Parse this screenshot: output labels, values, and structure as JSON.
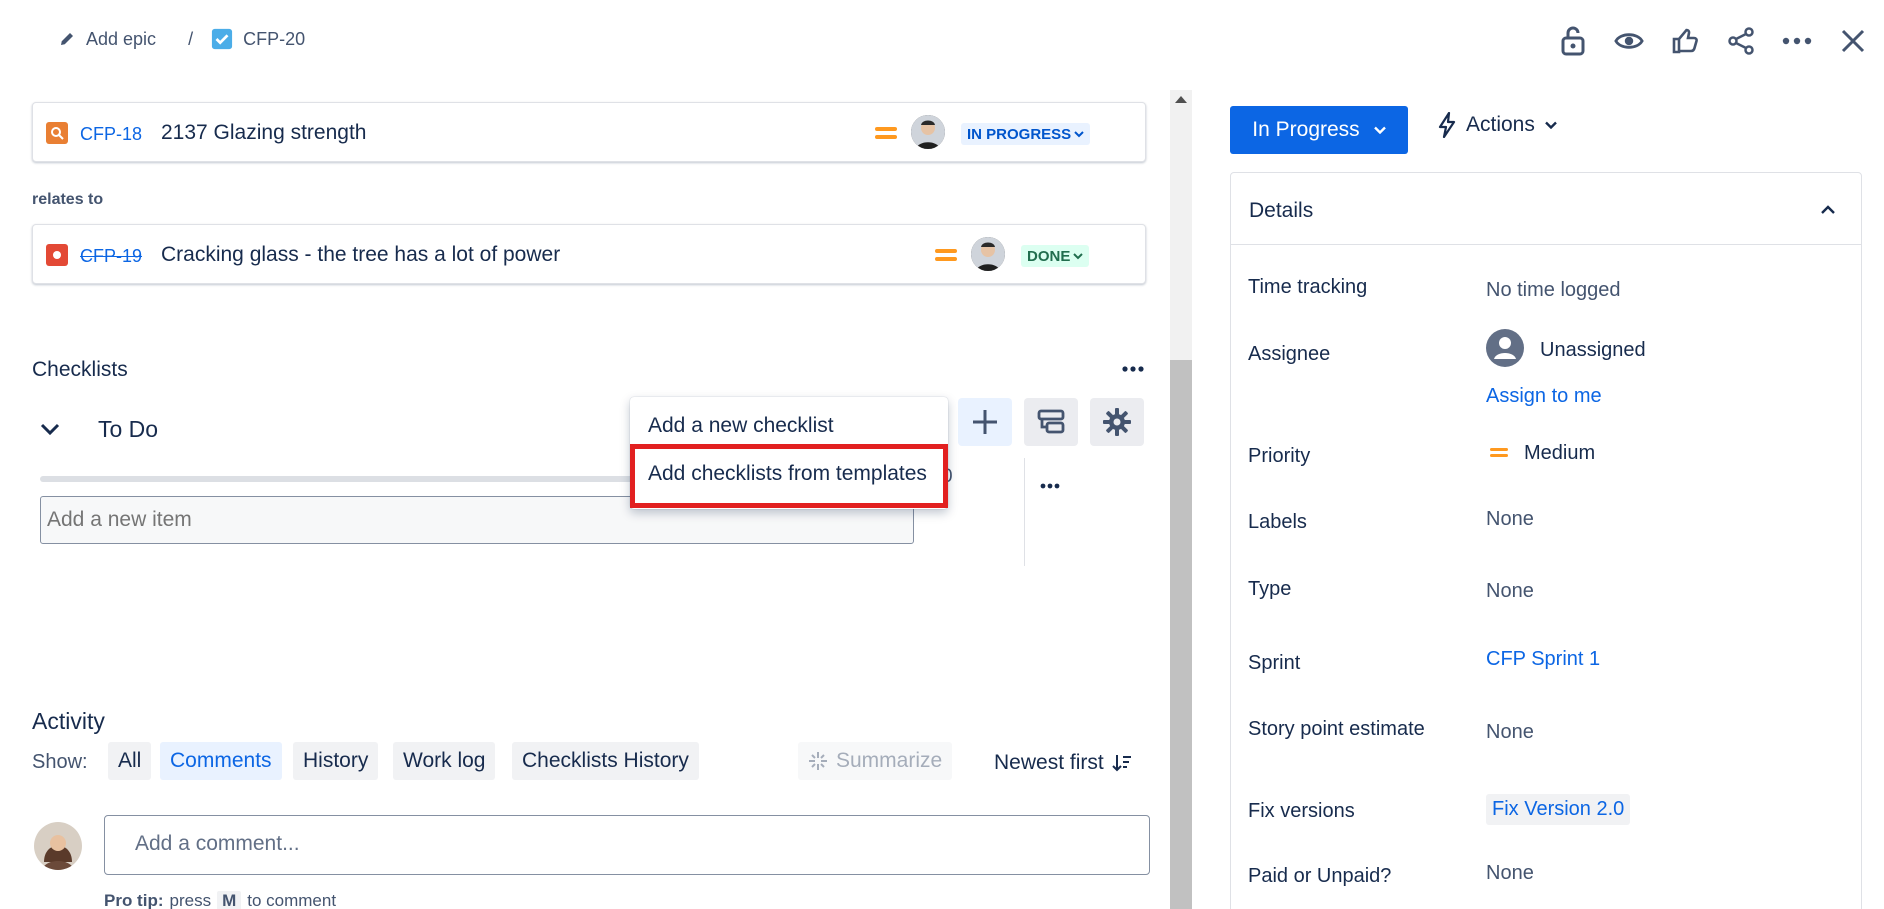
{
  "breadcrumb": {
    "epic_label": "Add epic",
    "separator": "/",
    "issue_key": "CFP-20"
  },
  "links": [
    {
      "key": "CFP-18",
      "summary": "2137 Glazing strength",
      "status": "IN PROGRESS",
      "type_color": "#e97f33",
      "done": false
    },
    {
      "section": "relates to"
    },
    {
      "key": "CFP-19",
      "summary": "Cracking glass - the tree has a lot of power",
      "status": "DONE",
      "type_color": "#e34935",
      "done": true
    }
  ],
  "checklists": {
    "title": "Checklists",
    "more": "...",
    "group_title": "To Do",
    "progress_text": "0",
    "add_item_placeholder": "Add a new item",
    "item_more": "...",
    "menu": {
      "item1": "Add a new checklist",
      "item2": "Add checklists from templates"
    }
  },
  "activity": {
    "title": "Activity",
    "show_label": "Show:",
    "filters": [
      "All",
      "Comments",
      "History",
      "Work log",
      "Checklists History"
    ],
    "summarize": "Summarize",
    "sort": "Newest first",
    "comment_placeholder": "Add a comment...",
    "tip_prefix": "Pro tip:",
    "tip_press": "press",
    "tip_key": "M",
    "tip_suffix": "to comment"
  },
  "panel": {
    "status": "In Progress",
    "actions": "Actions",
    "details_title": "Details",
    "fields": {
      "time_tracking": {
        "label": "Time tracking",
        "value": "No time logged"
      },
      "assignee": {
        "label": "Assignee",
        "value": "Unassigned",
        "assign_link": "Assign to me"
      },
      "priority": {
        "label": "Priority",
        "value": "Medium"
      },
      "labels": {
        "label": "Labels",
        "value": "None"
      },
      "type": {
        "label": "Type",
        "value": "None"
      },
      "sprint": {
        "label": "Sprint",
        "value": "CFP Sprint 1"
      },
      "story_points": {
        "label": "Story point estimate",
        "value": "None"
      },
      "fix_versions": {
        "label": "Fix versions",
        "value": "Fix Version 2.0"
      },
      "paid": {
        "label": "Paid or Unpaid?",
        "value": "None"
      }
    }
  },
  "colors": {
    "primary": "#0c66e4",
    "priority_medium": "#ff991f",
    "highlight": "#e22020",
    "done_green": "#216e4e",
    "in_progress_blue": "#0055cc"
  },
  "icons": [
    "pencil-icon",
    "checkbox-icon",
    "unlock-icon",
    "eye-icon",
    "thumbs-up-icon",
    "share-icon",
    "more-icon",
    "close-icon",
    "search-icon",
    "bug-icon",
    "chevron-down-icon",
    "plus-icon",
    "template-icon",
    "gear-icon",
    "sparkle-icon",
    "sort-icon",
    "lightning-icon",
    "chevron-up-icon",
    "person-icon"
  ]
}
